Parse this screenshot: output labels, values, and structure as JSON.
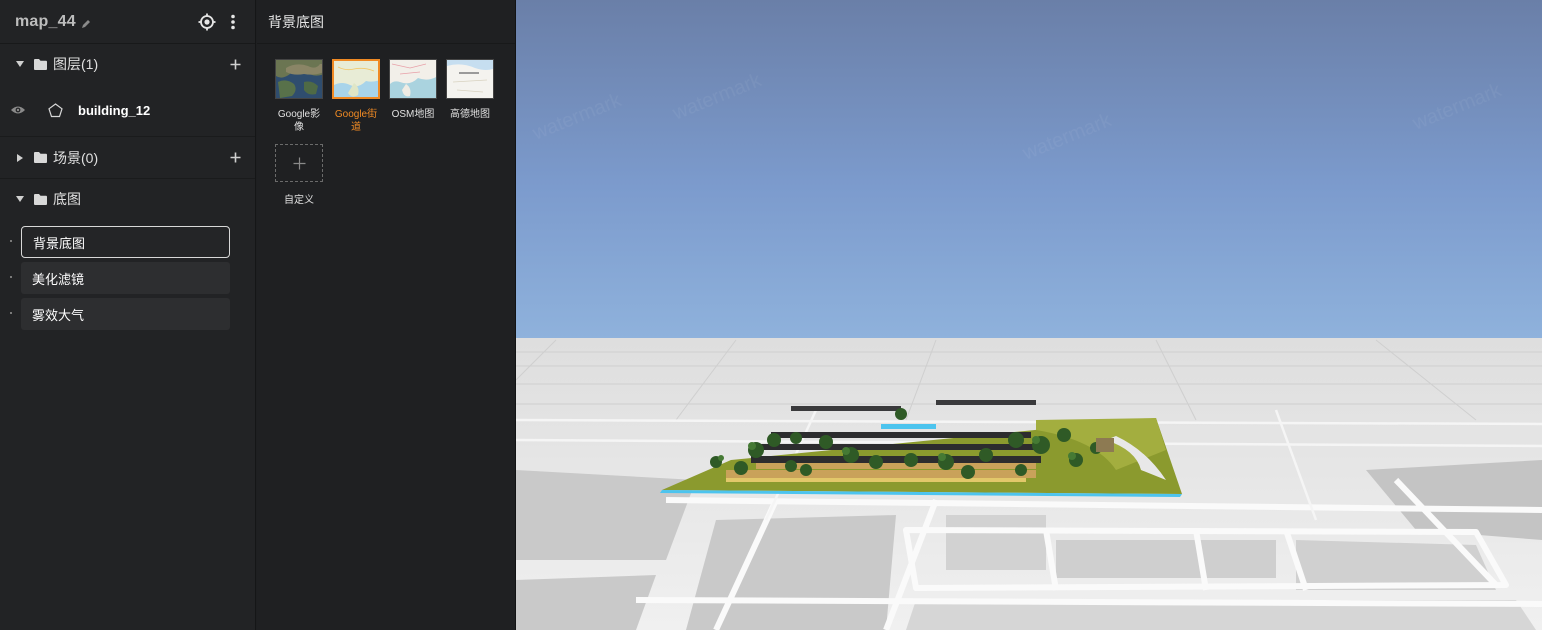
{
  "app": {
    "title": "map_44"
  },
  "sections": {
    "layers": {
      "label": "图层(1)",
      "expanded": true
    },
    "scenes": {
      "label": "场景(0)",
      "expanded": false
    },
    "basemap": {
      "label": "底图",
      "expanded": true
    }
  },
  "layers": [
    {
      "name": "building_12",
      "visible": true,
      "icon": "polygon-icon"
    }
  ],
  "basemap_items": [
    {
      "label": "背景底图",
      "active": true
    },
    {
      "label": "美化滤镜",
      "active": false
    },
    {
      "label": "雾效大气",
      "active": false
    }
  ],
  "panel": {
    "title": "背景底图",
    "thumbnails": [
      {
        "label": "Google影像",
        "selected": false
      },
      {
        "label": "Google街道",
        "selected": true
      },
      {
        "label": "OSM地图",
        "selected": false
      },
      {
        "label": "高德地图",
        "selected": false
      }
    ],
    "custom_label": "自定义"
  },
  "colors": {
    "accent": "#f08a24",
    "panel_bg": "#222325",
    "sky_top": "#6a7fa8",
    "sky_bottom": "#8fb2dc"
  }
}
